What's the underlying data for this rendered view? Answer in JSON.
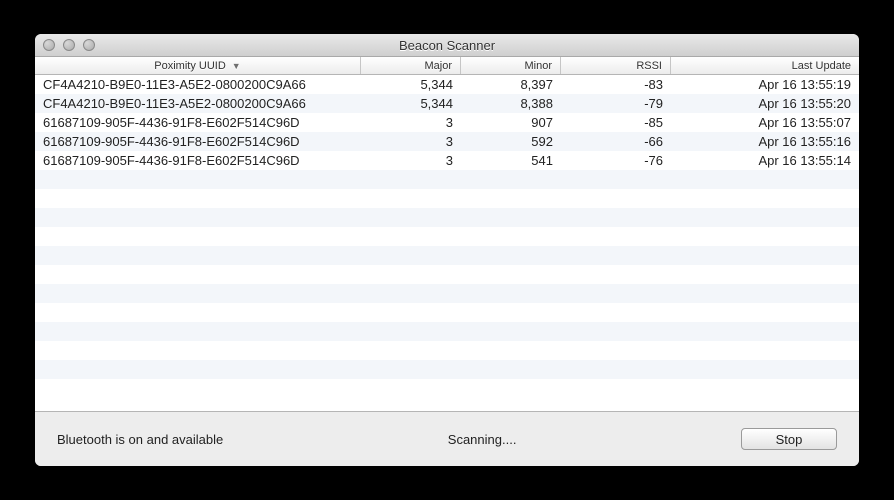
{
  "window": {
    "title": "Beacon Scanner"
  },
  "columns": {
    "uuid_label": "Poximity UUID",
    "major_label": "Major",
    "minor_label": "Minor",
    "rssi_label": "RSSI",
    "last_label": "Last Update"
  },
  "rows": [
    {
      "uuid": "CF4A4210-B9E0-11E3-A5E2-0800200C9A66",
      "major": "5,344",
      "minor": "8,397",
      "rssi": "-83",
      "last": "Apr 16 13:55:19"
    },
    {
      "uuid": "CF4A4210-B9E0-11E3-A5E2-0800200C9A66",
      "major": "5,344",
      "minor": "8,388",
      "rssi": "-79",
      "last": "Apr 16 13:55:20"
    },
    {
      "uuid": "61687109-905F-4436-91F8-E602F514C96D",
      "major": "3",
      "minor": "907",
      "rssi": "-85",
      "last": "Apr 16 13:55:07"
    },
    {
      "uuid": "61687109-905F-4436-91F8-E602F514C96D",
      "major": "3",
      "minor": "592",
      "rssi": "-66",
      "last": "Apr 16 13:55:16"
    },
    {
      "uuid": "61687109-905F-4436-91F8-E602F514C96D",
      "major": "3",
      "minor": "541",
      "rssi": "-76",
      "last": "Apr 16 13:55:14"
    }
  ],
  "empty_row_count": 12,
  "status": {
    "bluetooth": "Bluetooth is on and available",
    "scanning": "Scanning....",
    "stop_label": "Stop"
  }
}
